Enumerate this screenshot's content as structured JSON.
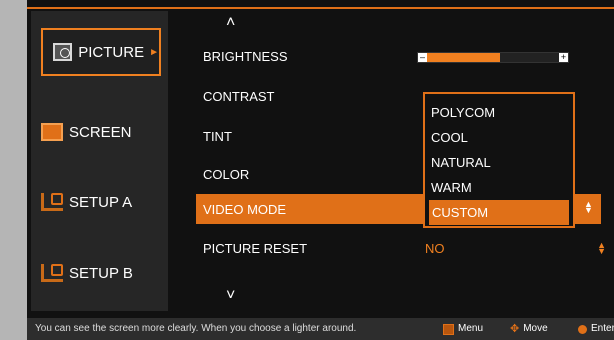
{
  "sidebar": {
    "items": [
      {
        "label": "PICTURE",
        "icon": "picture-icon",
        "selected": true
      },
      {
        "label": "SCREEN",
        "icon": "screen-icon"
      },
      {
        "label": "SETUP A",
        "icon": "setup-icon"
      },
      {
        "label": "SETUP B",
        "icon": "setup-icon"
      }
    ]
  },
  "settings": {
    "brightness": {
      "label": "BRIGHTNESS",
      "level": 0.55
    },
    "contrast": {
      "label": "CONTRAST"
    },
    "tint": {
      "label": "TINT"
    },
    "color": {
      "label": "COLOR"
    },
    "video_mode": {
      "label": "VIDEO MODE",
      "value": "CUSTOM"
    },
    "picture_reset": {
      "label": "PICTURE RESET",
      "value": "NO"
    }
  },
  "dropdown": {
    "options": [
      "POLYCOM",
      "COOL",
      "NATURAL",
      "WARM",
      "CUSTOM"
    ],
    "selected": "CUSTOM"
  },
  "footer": {
    "hint": "You can see the screen more clearly. When you choose a lighter around.",
    "menu_label": "Menu",
    "move_label": "Move",
    "enter_label": "Enter"
  },
  "colors": {
    "accent": "#e07018",
    "background": "#111111",
    "sidebar": "#262626"
  }
}
